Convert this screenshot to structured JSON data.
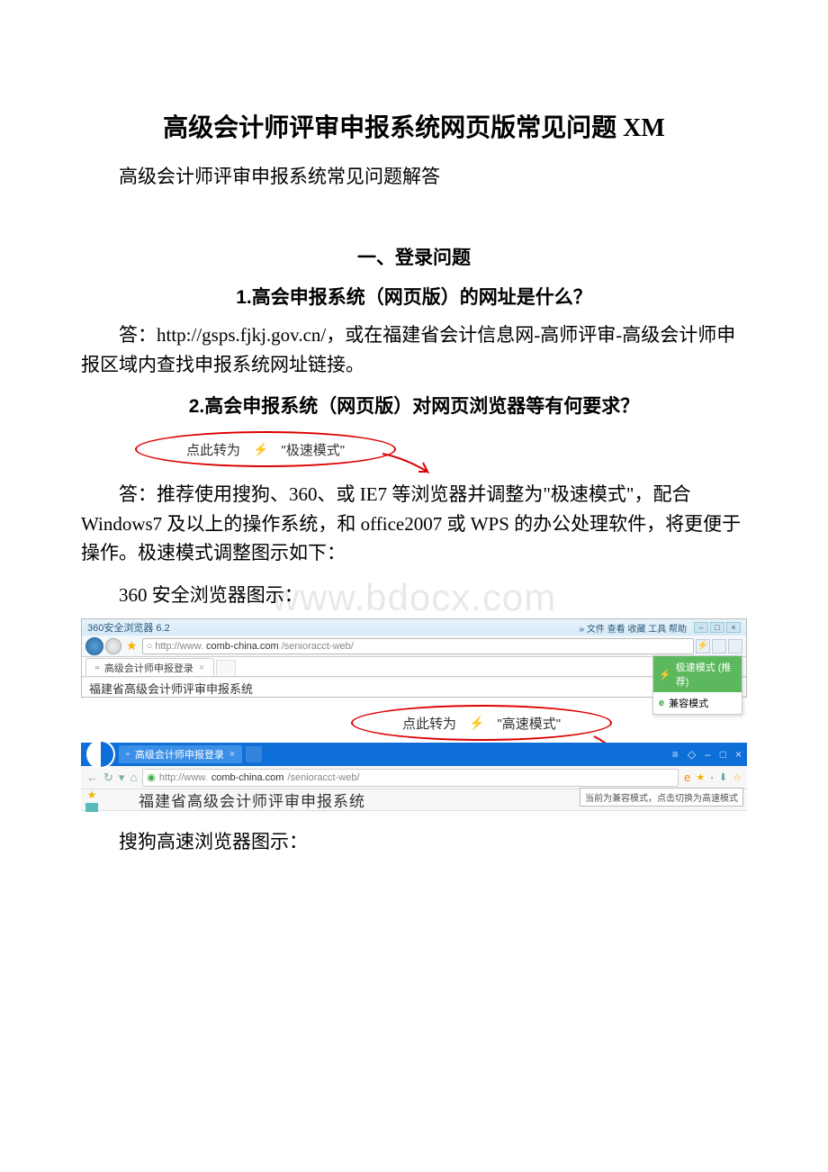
{
  "doc": {
    "title": "高级会计师评审申报系统网页版常见问题 XM",
    "subtitle": "高级会计师评审申报系统常见问题解答",
    "section1_heading": "一、登录问题",
    "q1": "1.高会申报系统（网页版）的网址是什么？",
    "a1": "答：http://gsps.fjkj.gov.cn/，或在福建省会计信息网-高师评审-高级会计师申报区域内查找申报系统网址链接。",
    "q2": "2.高会申报系统（网页版）对网页浏览器等有何要求？",
    "callout1_prefix": "点此转为",
    "callout1_mode": "\"极速模式\"",
    "a2": "答：推荐使用搜狗、360、或 IE7 等浏览器并调整为\"极速模式\"，配合 Windows7 及以上的操作系统，和 office2007 或 WPS 的办公处理软件，将更便于操作。极速模式调整图示如下：",
    "label_360": "360 安全浏览器图示：",
    "callout2_prefix": "点此转为",
    "callout2_mode": "\"高速模式\"",
    "label_sogou": "搜狗高速浏览器图示：",
    "watermark": "www.bdocx.com"
  },
  "browser360": {
    "title": "360安全浏览器 6.2",
    "menu": "» 文件 查看 收藏 工具 帮助",
    "url_prefix": "http://www.",
    "url_domain": "comb-china.com",
    "url_path": "/senioracct-web/",
    "tab_title": "高级会计师申报登录",
    "dd_fast": "极速模式 (推荐)",
    "dd_compat": "兼容模式",
    "content_text": "福建省高级会计师评审申报系统"
  },
  "sogou": {
    "tab_title": "高级会计师申报登录",
    "url_prefix": "http://www.",
    "url_domain": "comb-china.com",
    "url_path": "/senioracct-web/",
    "content_text": "福建省高级会计师评审申报系统",
    "hint": "当前为兼容模式，点击切换为高速模式"
  }
}
